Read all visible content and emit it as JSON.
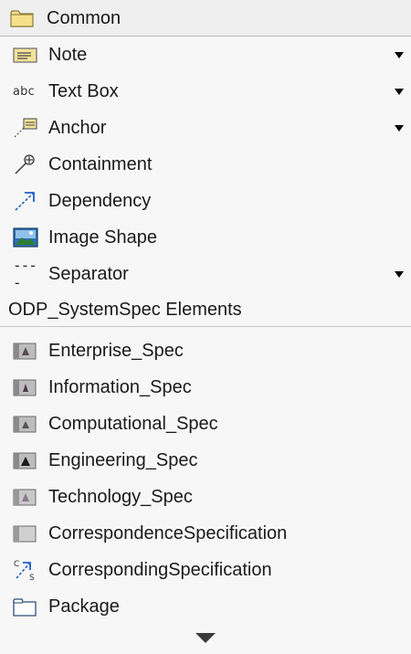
{
  "common": {
    "title": "Common",
    "icon": "folder-icon",
    "items": [
      {
        "label": "Note",
        "icon": "note-icon",
        "has_dropdown": true
      },
      {
        "label": "Text Box",
        "icon": "abc",
        "has_dropdown": true
      },
      {
        "label": "Anchor",
        "icon": "anchor-icon",
        "has_dropdown": true
      },
      {
        "label": "Containment",
        "icon": "containment-icon",
        "has_dropdown": false
      },
      {
        "label": "Dependency",
        "icon": "dependency-icon",
        "has_dropdown": false
      },
      {
        "label": "Image Shape",
        "icon": "image-icon",
        "has_dropdown": false
      },
      {
        "label": "Separator",
        "icon": "----",
        "has_dropdown": true
      }
    ]
  },
  "odp": {
    "title": "ODP_SystemSpec Elements",
    "items": [
      {
        "label": "Enterprise_Spec",
        "icon": "enterprise-spec-icon"
      },
      {
        "label": "Information_Spec",
        "icon": "information-spec-icon"
      },
      {
        "label": "Computational_Spec",
        "icon": "computational-spec-icon"
      },
      {
        "label": "Engineering_Spec",
        "icon": "engineering-spec-icon"
      },
      {
        "label": "Technology_Spec",
        "icon": "technology-spec-icon"
      },
      {
        "label": "CorrespondenceSpecification",
        "icon": "correspondence-specification-icon"
      },
      {
        "label": "CorrespondingSpecification",
        "icon": "corresponding-specification-icon"
      },
      {
        "label": "Package",
        "icon": "package-icon"
      }
    ]
  },
  "colors": {
    "palette_bg": "#f7f7f7",
    "header_bg": "#efefef",
    "folder_yellow": "#f6e08a",
    "dependency_blue": "#1f5fc8"
  }
}
